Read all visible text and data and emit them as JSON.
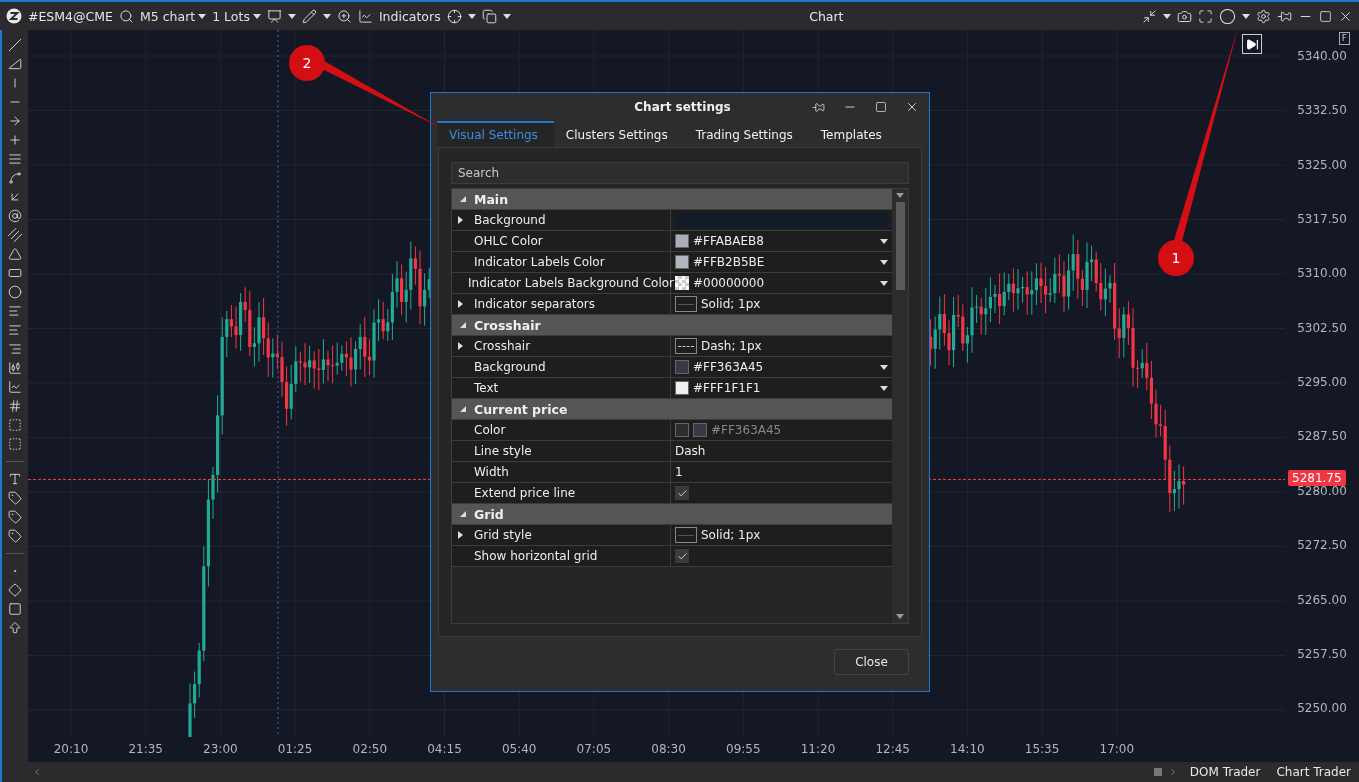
{
  "toolbar": {
    "symbol": "#ESM4@CME",
    "timeframe": "M5 chart",
    "lots": "1 Lots",
    "indicators": "Indicators",
    "title": "Chart"
  },
  "chart": {
    "scale_mode": "F",
    "current_price": "5281.75",
    "price_labels": [
      "5340.00",
      "5332.50",
      "5325.00",
      "5317.50",
      "5310.00",
      "5302.50",
      "5295.00",
      "5287.50",
      "5280.00",
      "5272.50",
      "5265.00",
      "5257.50",
      "5250.00"
    ],
    "time_labels": [
      "20:10",
      "21:35",
      "23:00",
      "01:25",
      "02:50",
      "04:15",
      "05:40",
      "07:05",
      "08:30",
      "09:55",
      "11:20",
      "12:45",
      "14:10",
      "15:35",
      "17:00"
    ]
  },
  "dialog": {
    "title": "Chart settings",
    "tabs": [
      {
        "label": "Visual Settings",
        "selected": true
      },
      {
        "label": "Clusters Settings",
        "selected": false
      },
      {
        "label": "Trading Settings",
        "selected": false
      },
      {
        "label": "Templates",
        "selected": false
      }
    ],
    "search": {
      "placeholder": "Search"
    },
    "rows": [
      {
        "kind": "section",
        "label": "Main",
        "expanded": true
      },
      {
        "kind": "property",
        "label": "Background",
        "expandable": true,
        "value": {
          "kind": "fill",
          "color": "#141b28"
        }
      },
      {
        "kind": "property",
        "label": "OHLC Color",
        "expandable": false,
        "value": {
          "kind": "color",
          "color": "#abaeb8",
          "text": "#FFABAEB8"
        }
      },
      {
        "kind": "property",
        "label": "Indicator Labels Color",
        "expandable": false,
        "value": {
          "kind": "color",
          "color": "#b2b5be",
          "text": "#FFB2B5BE"
        }
      },
      {
        "kind": "property",
        "label": "Indicator Labels Background Color",
        "expandable": false,
        "value": {
          "kind": "transparent_color",
          "text": "#00000000"
        }
      },
      {
        "kind": "property",
        "label": "Indicator separators",
        "expandable": true,
        "value": {
          "kind": "solid_line",
          "text": "Solid; 1px"
        }
      },
      {
        "kind": "section",
        "label": "Crosshair",
        "expanded": true
      },
      {
        "kind": "property",
        "label": "Crosshair",
        "expandable": true,
        "value": {
          "kind": "dash_line",
          "text": "Dash; 1px"
        }
      },
      {
        "kind": "property",
        "label": "Background",
        "expandable": false,
        "value": {
          "kind": "color",
          "color": "#363a45",
          "text": "#FF363A45"
        }
      },
      {
        "kind": "property",
        "label": "Text",
        "expandable": false,
        "value": {
          "kind": "color",
          "color": "#f1f1f1",
          "text": "#FFF1F1F1"
        }
      },
      {
        "kind": "section",
        "label": "Current price",
        "expanded": true
      },
      {
        "kind": "property",
        "label": "Color",
        "expandable": false,
        "value": {
          "kind": "disabled_color",
          "color": "#363a45",
          "text": "#FF363A45"
        }
      },
      {
        "kind": "property",
        "label": "Line style",
        "expandable": false,
        "value": {
          "kind": "text",
          "text": "Dash"
        }
      },
      {
        "kind": "property",
        "label": "Width",
        "expandable": false,
        "value": {
          "kind": "text",
          "text": "1"
        }
      },
      {
        "kind": "property",
        "label": "Extend price line",
        "expandable": false,
        "value": {
          "kind": "checkbox",
          "checked": true
        }
      },
      {
        "kind": "section",
        "label": "Grid",
        "expanded": true
      },
      {
        "kind": "property",
        "label": "Grid style",
        "expandable": true,
        "value": {
          "kind": "solid_line",
          "text": "Solid; 1px"
        }
      },
      {
        "kind": "property",
        "label": "Show horizontal grid",
        "expandable": false,
        "value": {
          "kind": "checkbox",
          "checked": true
        }
      }
    ],
    "close_button": "Close"
  },
  "bottom_tabs": [
    "DOM Trader",
    "Chart Trader"
  ],
  "callouts": [
    {
      "label": "1"
    },
    {
      "label": "2"
    }
  ]
}
